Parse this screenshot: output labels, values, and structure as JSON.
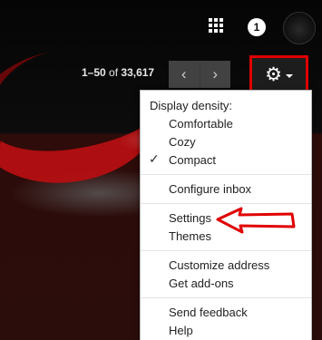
{
  "pager": {
    "range": "1–50",
    "of": "of",
    "total": "33,617",
    "prev_icon": "chevron-left-icon",
    "next_icon": "chevron-right-icon"
  },
  "topbar": {
    "notification_count": "1",
    "apps_icon": "apps-grid-icon"
  },
  "settings_button": {
    "icon": "gear-icon",
    "highlight_color": "#e00000"
  },
  "menu": {
    "density_header": "Display density:",
    "comfortable": "Comfortable",
    "cozy": "Cozy",
    "compact": "Compact",
    "selected_density": "Compact",
    "configure_inbox": "Configure inbox",
    "settings": "Settings",
    "themes": "Themes",
    "customize_address": "Customize address",
    "get_addons": "Get add-ons",
    "send_feedback": "Send feedback",
    "help": "Help"
  },
  "annotation": {
    "arrow_color": "#e00000",
    "points_to": "Settings"
  }
}
